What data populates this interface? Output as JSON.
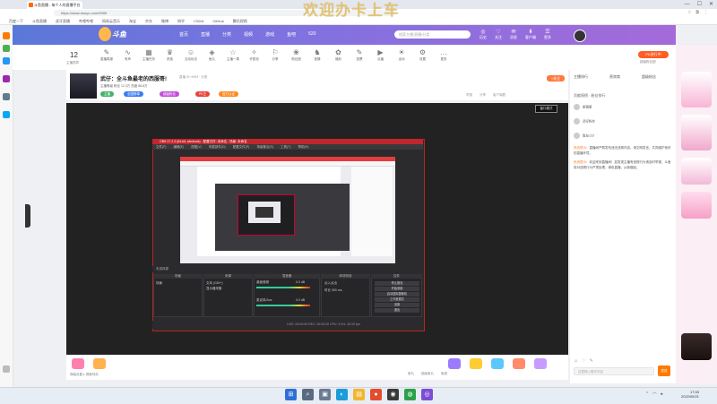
{
  "browser": {
    "tab_title": "斗鱼直播 - 每个人的直播平台",
    "url": "https://www.douyu.com/9999",
    "bookmarks": [
      "百度一下",
      "斗鱼直播",
      "虎牙直播",
      "哔哩哔哩",
      "网易云音乐",
      "淘宝",
      "京东",
      "微博",
      "知乎",
      "CSDN",
      "GitHub",
      "腾讯视频"
    ],
    "window_controls": [
      "—",
      "☐",
      "✕"
    ]
  },
  "watermark": "欢迎办卡上车",
  "site": {
    "logo": "斗鱼",
    "nav": [
      "首页",
      "直播",
      "分类",
      "视频",
      "游戏",
      "鱼吧",
      "520"
    ],
    "search_placeholder": "搜索主播/直播/分类",
    "header_icons": [
      {
        "icon": "◎",
        "label": "历史"
      },
      {
        "icon": "♡",
        "label": "关注"
      },
      {
        "icon": "✉",
        "label": "消息"
      },
      {
        "icon": "⬇",
        "label": "客户端"
      },
      {
        "icon": "☰",
        "label": "更多"
      }
    ]
  },
  "toolbar": {
    "count": "12",
    "count_label": "主播勋章",
    "tools": [
      {
        "icon": "✎",
        "label": "直播周报"
      },
      {
        "icon": "∿",
        "label": "有声"
      },
      {
        "icon": "▦",
        "label": "主播任务"
      },
      {
        "icon": "♛",
        "label": "贵族"
      },
      {
        "icon": "☺",
        "label": "互动玩法"
      },
      {
        "icon": "◈",
        "label": "鱼丸"
      },
      {
        "icon": "☆",
        "label": "主播一周"
      },
      {
        "icon": "✧",
        "label": "许愿池"
      },
      {
        "icon": "⚐",
        "label": "分享"
      },
      {
        "icon": "❀",
        "label": "粉丝团"
      },
      {
        "icon": "♞",
        "label": "竞猜"
      },
      {
        "icon": "✿",
        "label": "福利"
      },
      {
        "icon": "✎",
        "label": "投票"
      },
      {
        "icon": "▶",
        "label": "点播"
      },
      {
        "icon": "☀",
        "label": "活动"
      },
      {
        "icon": "⚙",
        "label": "设置"
      },
      {
        "icon": "…",
        "label": "更多"
      }
    ],
    "orange_button": "PK进行中",
    "orange_sub": "超级粉丝团"
  },
  "room": {
    "title": "武仔：全斗鱼最老的西服哥!",
    "meta": "直播  ID: 9999 · 分类",
    "sub": "主播等级  粉丝 12.3万  热度 88.8万",
    "tags": [
      "主播",
      "全国榜单",
      "超级粉丝",
      "PK王",
      "官方认证"
    ],
    "follow": "+关注",
    "tools": [
      "举报",
      "分享",
      "客户端看"
    ]
  },
  "player": {
    "fullscreen_label": "窗口模式"
  },
  "obs": {
    "title": "OBS 27.2.3 (64-bit, windows) - 配置文件: 未命名 - 场景: 未命名",
    "menu": [
      "文件(F)",
      "编辑(E)",
      "视图(V)",
      "停靠部件(D)",
      "配置文件(P)",
      "场景集合(S)",
      "工具(T)",
      "帮助(H)"
    ],
    "scene_bar": "未选择源",
    "docks": {
      "scenes": "场景",
      "sources": "来源",
      "mixer": "混音器",
      "transitions": "转场特效",
      "controls": "控件"
    },
    "scene_item": "场景",
    "source_items": [
      "文本 (GDI+)",
      "显示器采集"
    ],
    "mixer_items": [
      "桌面音频",
      "麦克风/Aux"
    ],
    "mixer_values": [
      "0.0 dB",
      "0.0 dB"
    ],
    "transition_values": [
      "淡入淡出",
      "时长 300 ms"
    ],
    "control_buttons": [
      "停止推流",
      "开始录制",
      "启动虚拟摄像机",
      "工作室模式",
      "设置",
      "退出"
    ],
    "status": "LIVE: 00:00:00   REC: 00:00:00   CPU: 3.0%, 30.00 fps"
  },
  "gifts": [
    "#ff7fae",
    "#ffb24d",
    "#9b7bff",
    "#ffcc33",
    "#5cc7ff",
    "#ff8c6b",
    "#c79bff"
  ],
  "danmu_setting": "弹幕设置 ▸ 屏蔽特效",
  "bottom_links": [
    "鱼丸",
    "超级鱼丸",
    "鱼翅"
  ],
  "rightpanel": {
    "tabs": [
      "主播排行",
      "贵宾席",
      "超级粉丝"
    ],
    "contrib": "贡献周榜 · 粉丝排行",
    "ranks": [
      "紫薇星",
      "武仔粉丝",
      "鱼友123"
    ],
    "chat": [
      {
        "user": "系统提示",
        "text": "：直播间严禁发布违法违规内容，请文明发言，共同维护良好的直播环境。"
      },
      {
        "user": "系统提示",
        "text": "：欢迎来到直播间！如发现主播有违规行为请及时举报，斗鱼将对违规行为严肃处理，绿色直播，从我做起。"
      }
    ],
    "input_placeholder": "这里输入聊天内容",
    "send": "发送",
    "chat_tools": [
      "☺",
      "♡",
      "✎"
    ]
  },
  "taskbar": {
    "icons": [
      {
        "glyph": "⊞",
        "color": "#2d6fd6"
      },
      {
        "glyph": "⌕",
        "color": "#5a6a80"
      },
      {
        "glyph": "▣",
        "color": "#6a7a90"
      },
      {
        "glyph": "◐",
        "color": "#1c9cd8"
      },
      {
        "glyph": "▤",
        "color": "#f2b630"
      },
      {
        "glyph": "●",
        "color": "#e34c2f"
      },
      {
        "glyph": "◉",
        "color": "#3a3a3a"
      },
      {
        "glyph": "◍",
        "color": "#2aa147"
      },
      {
        "glyph": "◎",
        "color": "#7c4dd6"
      }
    ],
    "time": "17:53",
    "date": "2022/05/21"
  }
}
